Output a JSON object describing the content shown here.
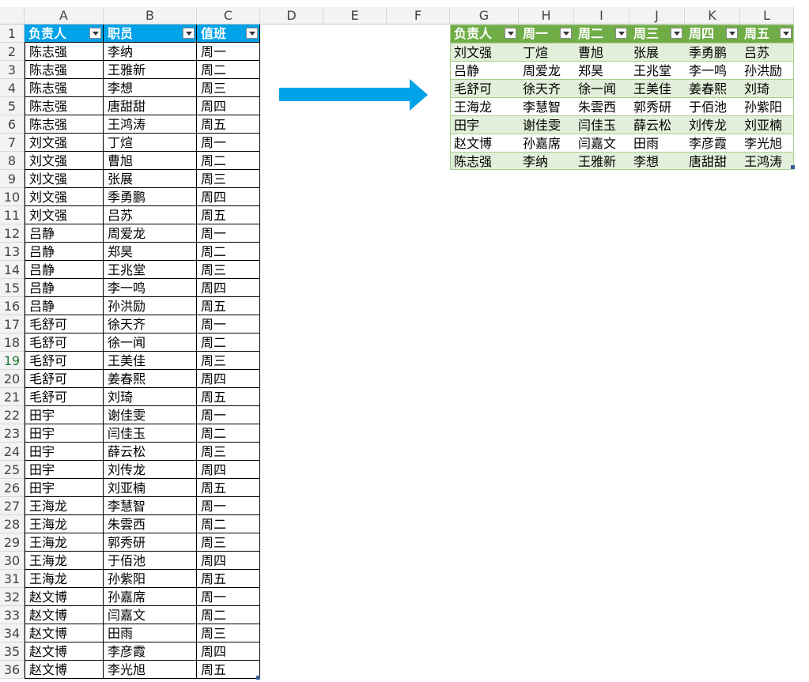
{
  "columns": [
    "A",
    "B",
    "C",
    "D",
    "E",
    "F",
    "G",
    "H",
    "I",
    "J",
    "K",
    "L"
  ],
  "rows": [
    "1",
    "2",
    "3",
    "4",
    "5",
    "6",
    "7",
    "8",
    "9",
    "10",
    "11",
    "12",
    "13",
    "14",
    "15",
    "16",
    "17",
    "18",
    "19",
    "20",
    "21",
    "22",
    "23",
    "24",
    "25",
    "26",
    "27",
    "28",
    "29",
    "30",
    "31",
    "32",
    "33",
    "34",
    "35",
    "36"
  ],
  "selected_row": "19",
  "colors": {
    "source_header": "#00a2e8",
    "result_header": "#70ad47",
    "result_band": "#e2efda",
    "arrow": "#00a2e8"
  },
  "source_table": {
    "headers": [
      "负责人",
      "职员",
      "值班"
    ],
    "rows": [
      [
        "陈志强",
        "李纳",
        "周一"
      ],
      [
        "陈志强",
        "王雅新",
        "周二"
      ],
      [
        "陈志强",
        "李想",
        "周三"
      ],
      [
        "陈志强",
        "唐甜甜",
        "周四"
      ],
      [
        "陈志强",
        "王鸿涛",
        "周五"
      ],
      [
        "刘文强",
        "丁煊",
        "周一"
      ],
      [
        "刘文强",
        "曹旭",
        "周二"
      ],
      [
        "刘文强",
        "张展",
        "周三"
      ],
      [
        "刘文强",
        "季勇鹏",
        "周四"
      ],
      [
        "刘文强",
        "吕苏",
        "周五"
      ],
      [
        "吕静",
        "周爱龙",
        "周一"
      ],
      [
        "吕静",
        "郑昊",
        "周二"
      ],
      [
        "吕静",
        "王兆堂",
        "周三"
      ],
      [
        "吕静",
        "李一鸣",
        "周四"
      ],
      [
        "吕静",
        "孙洪励",
        "周五"
      ],
      [
        "毛舒可",
        "徐天齐",
        "周一"
      ],
      [
        "毛舒可",
        "徐一闻",
        "周二"
      ],
      [
        "毛舒可",
        "王美佳",
        "周三"
      ],
      [
        "毛舒可",
        "姜春熙",
        "周四"
      ],
      [
        "毛舒可",
        "刘琦",
        "周五"
      ],
      [
        "田宇",
        "谢佳雯",
        "周一"
      ],
      [
        "田宇",
        "闫佳玉",
        "周二"
      ],
      [
        "田宇",
        "薛云松",
        "周三"
      ],
      [
        "田宇",
        "刘传龙",
        "周四"
      ],
      [
        "田宇",
        "刘亚楠",
        "周五"
      ],
      [
        "王海龙",
        "李慧智",
        "周一"
      ],
      [
        "王海龙",
        "朱雲西",
        "周二"
      ],
      [
        "王海龙",
        "郭秀研",
        "周三"
      ],
      [
        "王海龙",
        "于佰池",
        "周四"
      ],
      [
        "王海龙",
        "孙紫阳",
        "周五"
      ],
      [
        "赵文博",
        "孙嘉席",
        "周一"
      ],
      [
        "赵文博",
        "闫嘉文",
        "周二"
      ],
      [
        "赵文博",
        "田雨",
        "周三"
      ],
      [
        "赵文博",
        "李彦霞",
        "周四"
      ],
      [
        "赵文博",
        "李光旭",
        "周五"
      ]
    ]
  },
  "result_table": {
    "headers": [
      "负责人",
      "周一",
      "周二",
      "周三",
      "周四",
      "周五"
    ],
    "rows": [
      [
        "刘文强",
        "丁煊",
        "曹旭",
        "张展",
        "季勇鹏",
        "吕苏"
      ],
      [
        "吕静",
        "周爱龙",
        "郑昊",
        "王兆堂",
        "李一鸣",
        "孙洪励"
      ],
      [
        "毛舒可",
        "徐天齐",
        "徐一闻",
        "王美佳",
        "姜春熙",
        "刘琦"
      ],
      [
        "王海龙",
        "李慧智",
        "朱雲西",
        "郭秀研",
        "于佰池",
        "孙紫阳"
      ],
      [
        "田宇",
        "谢佳雯",
        "闫佳玉",
        "薛云松",
        "刘传龙",
        "刘亚楠"
      ],
      [
        "赵文博",
        "孙嘉席",
        "闫嘉文",
        "田雨",
        "李彦霞",
        "李光旭"
      ],
      [
        "陈志强",
        "李纳",
        "王雅新",
        "李想",
        "唐甜甜",
        "王鸿涛"
      ]
    ]
  }
}
